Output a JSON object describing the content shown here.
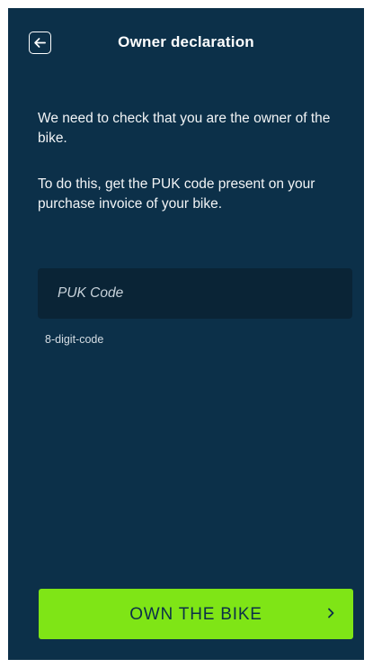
{
  "header": {
    "title": "Owner declaration",
    "back_icon": "arrow-left-icon"
  },
  "body": {
    "paragraph_1": "We need to check that you are the owner of the bike.",
    "paragraph_2": "To do this, get the PUK code present on your purchase invoice of your bike."
  },
  "puk_field": {
    "placeholder": "PUK Code",
    "value": "",
    "hint": "8-digit-code"
  },
  "cta": {
    "label": "OWN THE BIKE",
    "icon": "chevron-right-icon"
  },
  "colors": {
    "background": "#0c3049",
    "input_background": "#0a2436",
    "accent": "#7fe516"
  }
}
